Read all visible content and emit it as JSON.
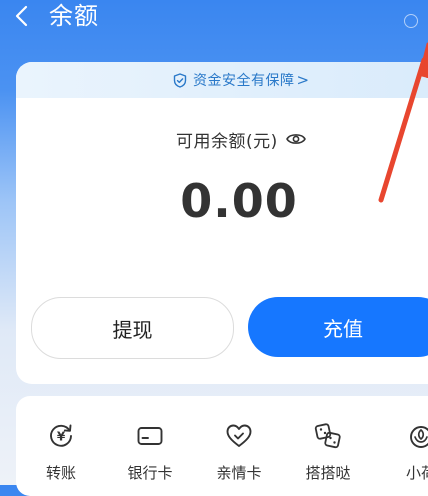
{
  "header": {
    "title": "余额",
    "back_icon": "chevron-left-icon",
    "help_icon": "help-circle-icon"
  },
  "safety": {
    "text": "资金安全有保障",
    "chevron": ">",
    "icon": "shield-check-icon"
  },
  "balance": {
    "label": "可用余额(元)",
    "eye_icon": "eye-icon",
    "amount": "0.00"
  },
  "actions": {
    "withdraw_label": "提现",
    "recharge_label": "充值"
  },
  "tools": [
    {
      "label": "转账",
      "icon": "yuan-refresh-icon"
    },
    {
      "label": "银行卡",
      "icon": "bank-card-icon"
    },
    {
      "label": "亲情卡",
      "icon": "heart-icon"
    },
    {
      "label": "搭搭哒",
      "icon": "dice-icon"
    },
    {
      "label": "小荷",
      "icon": "lotus-icon"
    }
  ],
  "colors": {
    "primary": "#1677ff",
    "header_bg": "#3a86f0",
    "annotation_arrow": "#e8462f"
  }
}
